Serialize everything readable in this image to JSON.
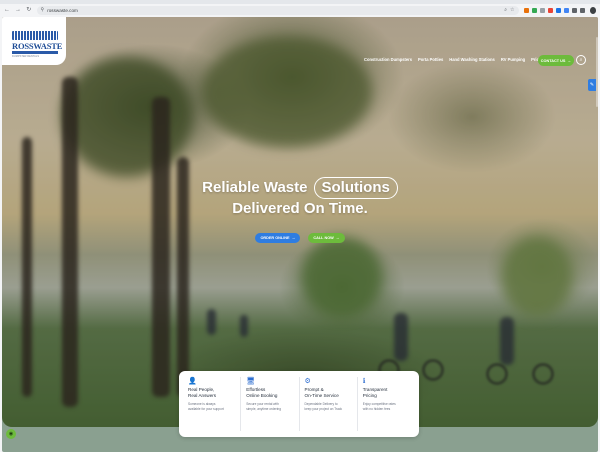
{
  "browser": {
    "url": "rosswaste.com",
    "back_glyph": "←",
    "forward_glyph": "→",
    "reload_glyph": "↻",
    "site_glyph": "⚲",
    "omni_icons": [
      "⌕",
      "☆"
    ],
    "extension_colors": [
      "#e8710a",
      "#34a853",
      "#9aa0a6",
      "#ea4335",
      "#1a73e8",
      "#4285f4",
      "#5f6368",
      "#5f6368"
    ]
  },
  "header": {
    "logo_text": "ROSSWASTE",
    "logo_tagline": "DUMPSTER RENTALS",
    "nav": [
      "Construction Dumpsters",
      "Porta Potties",
      "Hand Washing Stations",
      "RV Pumping",
      "Pricing & Details"
    ],
    "contact_label": "CONTACT US",
    "contact_arrow": "→",
    "search_glyph": "⌕"
  },
  "hero": {
    "line1_prefix": "Reliable Waste",
    "line1_pill": "Solutions",
    "line2": "Delivered On Time.",
    "cta_order": "ORDER ONLINE",
    "cta_call": "CALL NOW",
    "cta_arrow": "→"
  },
  "features": [
    {
      "icon": "👤",
      "title": "Real People,\nReal Answers",
      "desc": "Someone is always\navailable for your support"
    },
    {
      "icon": "🖥",
      "title": "Effortless\nOnline Booking",
      "desc": "Secure your rental with\nsimple, anytime ordering"
    },
    {
      "icon": "⚙",
      "title": "Prompt &\nOn-Time Service",
      "desc": "Dependable Delivery to\nkeep your project on Track"
    },
    {
      "icon": "ℹ",
      "title": "Transparent\nPricing",
      "desc": "Enjoy competitive rates\nwith no hidden fees"
    }
  ],
  "widgets": {
    "side_glyph": "✎",
    "chat_glyph": "◉"
  }
}
